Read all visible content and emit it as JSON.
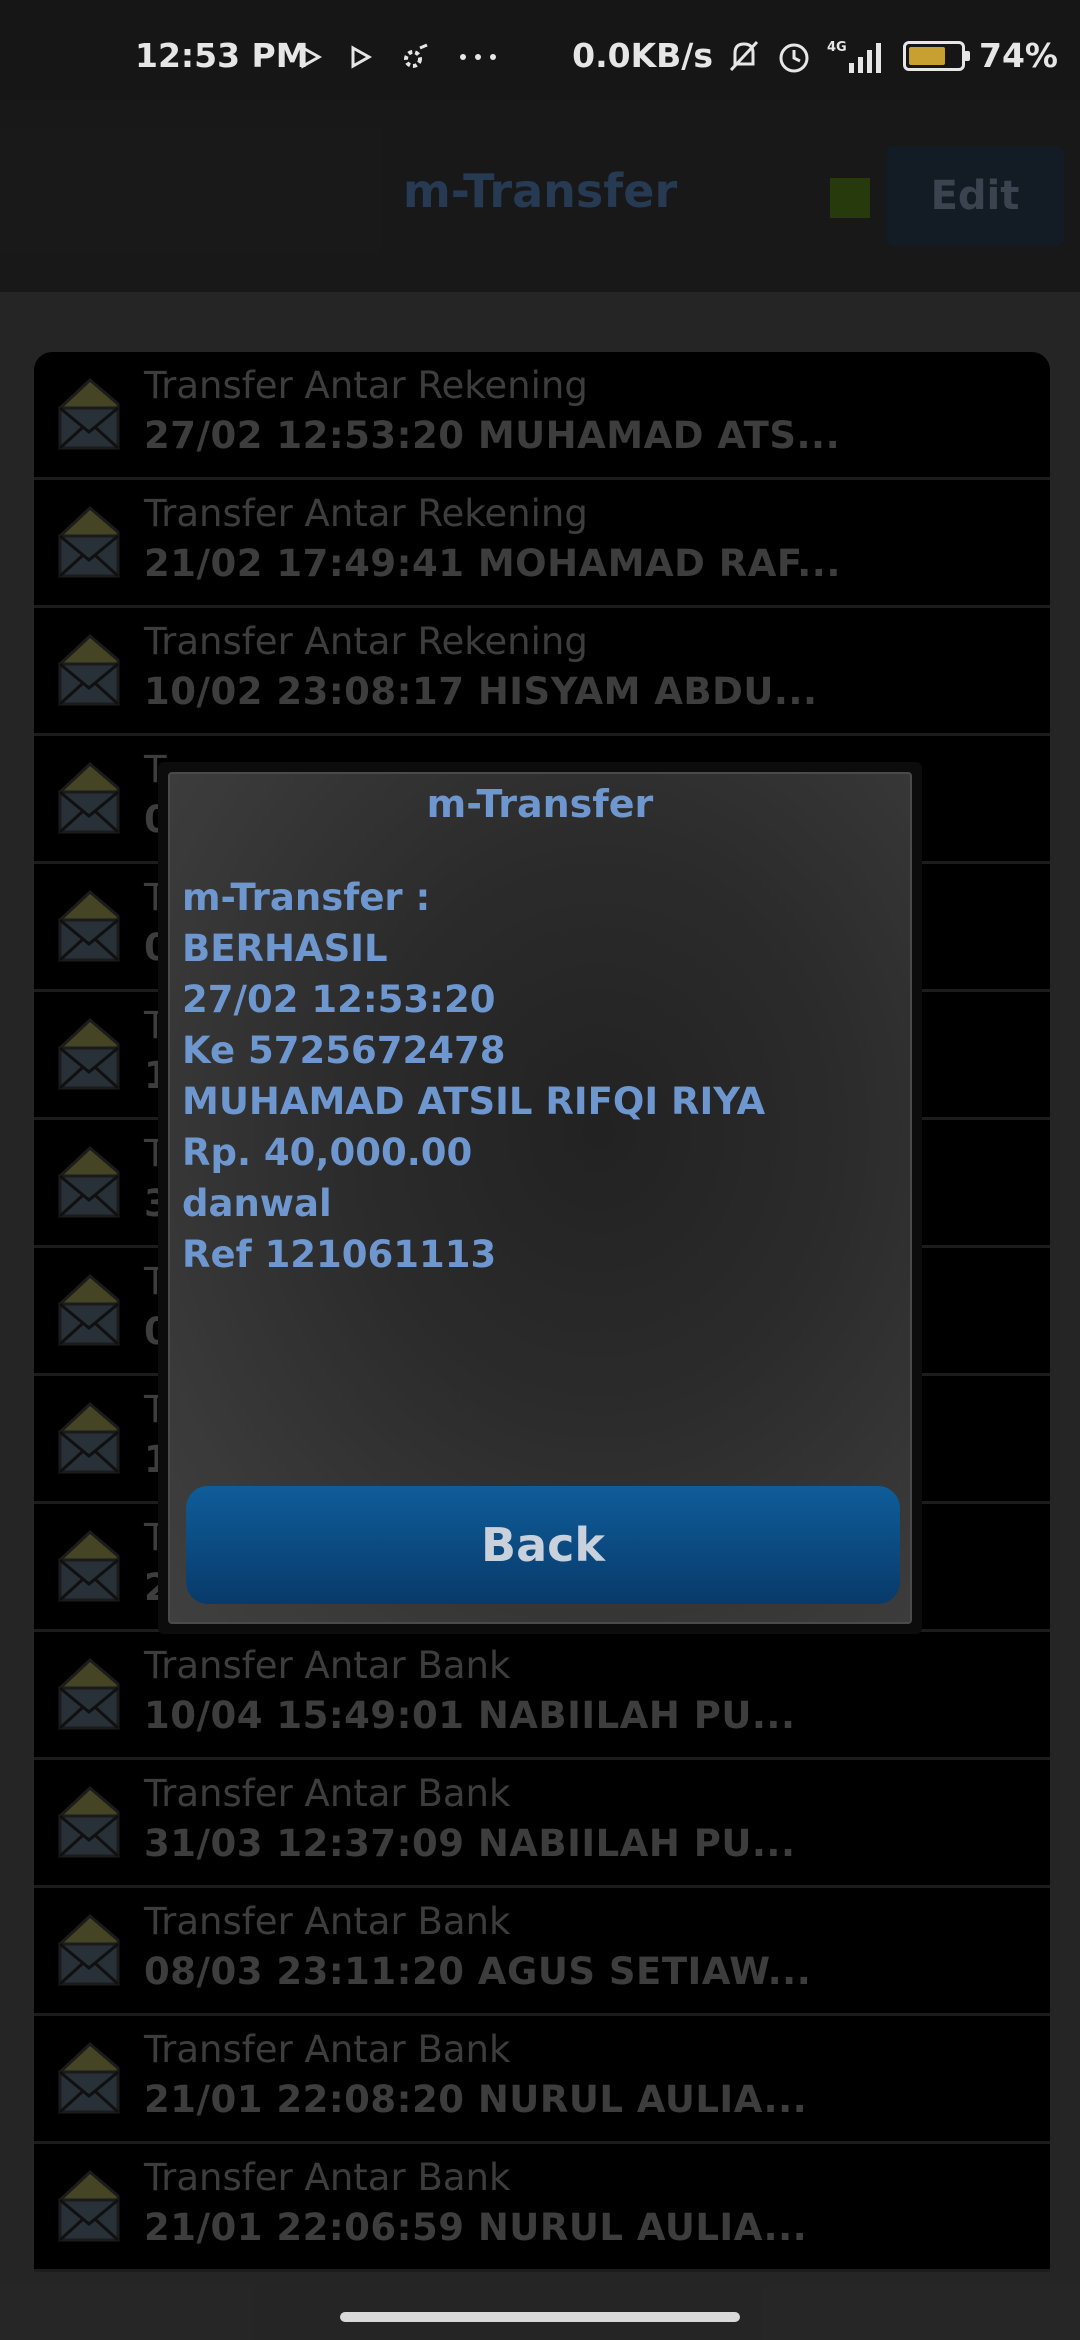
{
  "status_bar": {
    "time": "12:53 PM",
    "net_speed": "0.0KB/s",
    "network": "4G",
    "battery_pct": "74%",
    "battery_level": 0.74,
    "icons": [
      "play-icon",
      "play-icon",
      "settings-icon",
      "more-dots-icon",
      "mute-bell-icon",
      "alarm-icon",
      "signal-icon",
      "battery-icon"
    ]
  },
  "header": {
    "title": "m-Transfer",
    "edit_label": "Edit"
  },
  "list": {
    "items": [
      {
        "title": "Transfer Antar Rekening",
        "subtitle": "27/02 12:53:20 MUHAMAD ATS..."
      },
      {
        "title": "Transfer Antar Rekening",
        "subtitle": "21/02 17:49:41 MOHAMAD RAF..."
      },
      {
        "title": "Transfer Antar Rekening",
        "subtitle": "10/02 23:08:17 HISYAM ABDU..."
      },
      {
        "title": "T",
        "subtitle": "0"
      },
      {
        "title": "T",
        "subtitle": "0"
      },
      {
        "title": "T",
        "subtitle": "1"
      },
      {
        "title": "T",
        "subtitle": "3"
      },
      {
        "title": "T",
        "subtitle": "0"
      },
      {
        "title": "T",
        "subtitle": "1"
      },
      {
        "title": "T",
        "subtitle": "2"
      },
      {
        "title": "Transfer Antar Bank",
        "subtitle": "10/04 15:49:01 NABIILAH PU..."
      },
      {
        "title": "Transfer Antar Bank",
        "subtitle": "31/03 12:37:09 NABIILAH PU..."
      },
      {
        "title": "Transfer Antar Bank",
        "subtitle": "08/03 23:11:20 AGUS SETIAW..."
      },
      {
        "title": "Transfer Antar Bank",
        "subtitle": "21/01 22:08:20 NURUL AULIA..."
      },
      {
        "title": "Transfer Antar Bank",
        "subtitle": "21/01 22:06:59 NURUL AULIA..."
      }
    ]
  },
  "dialog": {
    "title": "m-Transfer",
    "lines": [
      "m-Transfer :",
      "BERHASIL",
      "27/02 12:53:20",
      "Ke 5725672478",
      "MUHAMAD ATSIL RIFQI RIYA",
      "Rp. 40,000.00",
      "danwal",
      "Ref 121061113"
    ],
    "back_label": "Back"
  },
  "colors": {
    "dialog_text": "#6f97cf",
    "button": "#0c4f86",
    "envelope": "#6b6a3a"
  }
}
